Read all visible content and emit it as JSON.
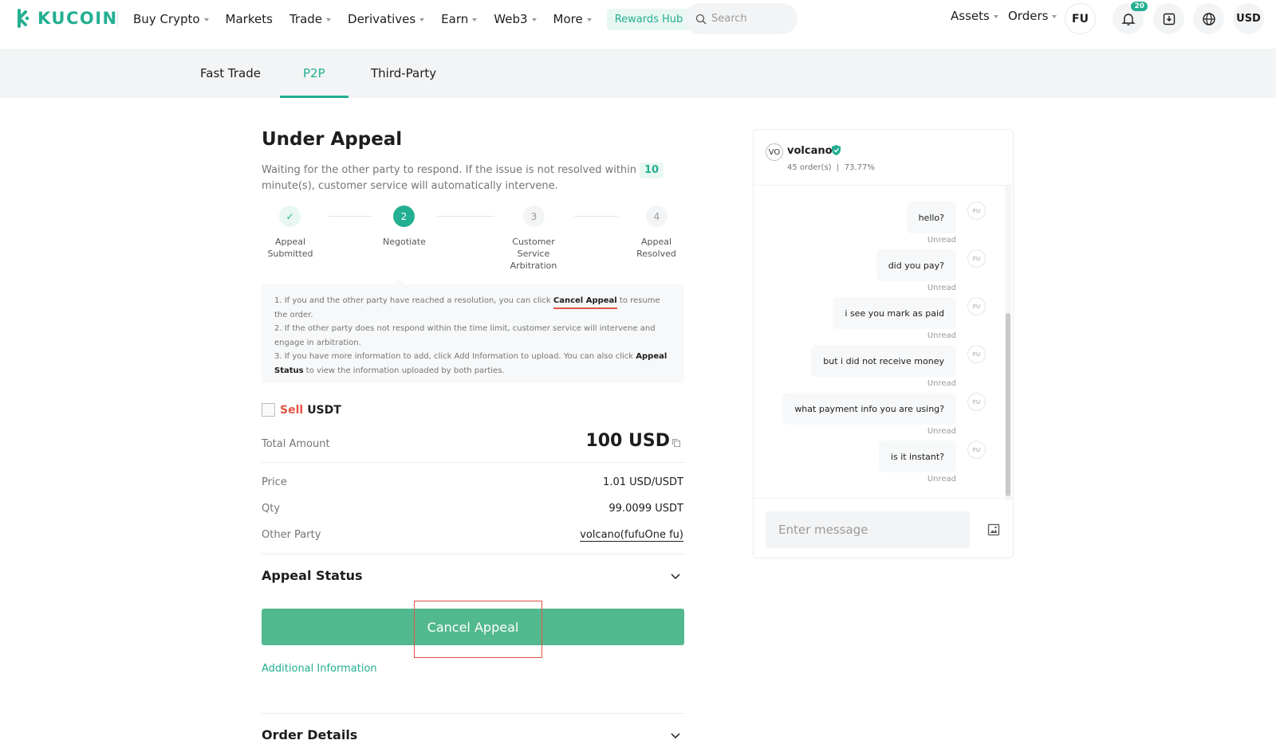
{
  "brand": {
    "name": "KUCOIN",
    "accent": "#23af91",
    "sell_color": "#e25544"
  },
  "nav": {
    "items": [
      {
        "label": "Buy Crypto",
        "caret": true
      },
      {
        "label": "Markets",
        "caret": false
      },
      {
        "label": "Trade",
        "caret": true
      },
      {
        "label": "Derivatives",
        "caret": true
      },
      {
        "label": "Earn",
        "caret": true
      },
      {
        "label": "Web3",
        "caret": true
      },
      {
        "label": "More",
        "caret": true
      }
    ],
    "rewards_label": "Rewards Hub",
    "search_placeholder": "Search",
    "assets_label": "Assets",
    "orders_label": "Orders",
    "user_initials": "FU",
    "notification_count": "20",
    "currency": "USD"
  },
  "subnav": {
    "tabs": [
      {
        "label": "Fast Trade",
        "active": false
      },
      {
        "label": "P2P",
        "active": true
      },
      {
        "label": "Third-Party",
        "active": false
      }
    ]
  },
  "appeal": {
    "title": "Under Appeal",
    "subtitle_prefix": "Waiting for the other party to respond. If the issue is not resolved within",
    "minutes": "10",
    "subtitle_suffix": "minute(s), customer service will automatically intervene.",
    "steps": [
      {
        "num": "✓",
        "label": "Appeal Submitted",
        "state": "done"
      },
      {
        "num": "2",
        "label": "Negotiate",
        "state": "active"
      },
      {
        "num": "3",
        "label": "Customer Service Arbitration",
        "state": "pending"
      },
      {
        "num": "4",
        "label": "Appeal Resolved",
        "state": "pending"
      }
    ],
    "notice": {
      "line1_a": "1. If you and the other party have reached a resolution, you can click",
      "line1_link": "Cancel Appeal",
      "line1_b": "to resume the order.",
      "line2": "2. If the other party does not respond within the time limit, customer service will intervene and engage in arbitration.",
      "line3_a": "3. If you have more information to add, click Add Information to upload. You can also click",
      "line3_link": "Appeal Status",
      "line3_b": "to view the information uploaded by both parties."
    }
  },
  "order": {
    "side": "Sell",
    "asset": "USDT",
    "total_label": "Total Amount",
    "total_value": "100 USD",
    "price_label": "Price",
    "price_value": "1.01 USD/USDT",
    "qty_label": "Qty",
    "qty_value": "99.0099 USDT",
    "party_label": "Other Party",
    "party_value": "volcano(fufuOne fu)",
    "appeal_status_label": "Appeal Status",
    "cancel_button": "Cancel Appeal",
    "additional_info": "Additional Information",
    "order_details_label": "Order Details"
  },
  "chat": {
    "avatar": "VO",
    "name": "volcano",
    "orders": "45 order(s)",
    "completion": "73.77%",
    "sender_avatar": "FU",
    "messages": [
      {
        "text": "hello?",
        "status": "Unread"
      },
      {
        "text": "did you pay?",
        "status": "Unread"
      },
      {
        "text": "i see you mark as paid",
        "status": "Unread"
      },
      {
        "text": "but i did not receive money",
        "status": "Unread"
      },
      {
        "text": "what payment info you are using?",
        "status": "Unread"
      },
      {
        "text": "is it instant?",
        "status": "Unread"
      }
    ],
    "input_placeholder": "Enter message"
  }
}
